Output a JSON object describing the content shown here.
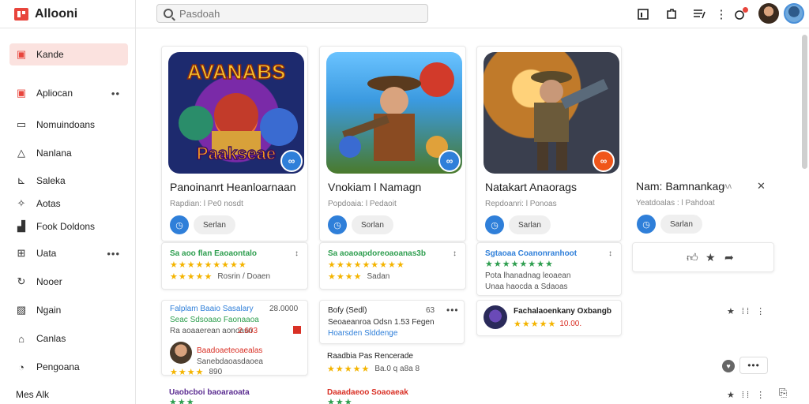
{
  "app": {
    "title": "Allooni"
  },
  "search": {
    "placeholder": "Pasdoah"
  },
  "topbar": {
    "icons": [
      "library-icon",
      "puzzle-icon",
      "list-icon",
      "more-vertical-icon",
      "notifications-icon",
      "profile-avatar",
      "account-avatar"
    ]
  },
  "sidebar": {
    "items": [
      {
        "label": "Kande",
        "icon": "home-icon",
        "active": true
      },
      {
        "label": "Apliocan",
        "icon": "apps-icon",
        "more": "••"
      },
      {
        "label": "Nomuindoans",
        "icon": "window-icon"
      },
      {
        "label": "Nanlana",
        "icon": "triangle-icon"
      },
      {
        "label": "Saleka",
        "icon": "chart-icon"
      },
      {
        "label": "Aotas",
        "icon": "star-icon"
      },
      {
        "label": "Fook Doldons",
        "icon": "bar-chart-icon"
      },
      {
        "label": "Uata",
        "icon": "grid-icon",
        "more": "•••"
      },
      {
        "label": "Nooer",
        "icon": "refresh-icon"
      },
      {
        "label": "Ngain",
        "icon": "image-icon"
      },
      {
        "label": "Canlas",
        "icon": "house-icon"
      },
      {
        "label": "Pengoana",
        "icon": "clock-icon"
      },
      {
        "label": "Mes Alk"
      }
    ]
  },
  "games": [
    {
      "title": "Panoinanrt Heanloarnaan",
      "sub": "Rapdian: l Pe0 nosdt",
      "pill": "Serlan",
      "art_text": "AVANABS",
      "art_text2": "Paakseae",
      "badge_color": "#2f7fd9"
    },
    {
      "title": "Vnokiam l Namagn",
      "sub": "Popdoaia: l Pedaoit",
      "pill": "Sorlan",
      "badge_color": "#2f7fd9"
    },
    {
      "title": "Natakart Anaorags",
      "sub": "Repdoanri: l Ponoas",
      "pill": "Sarlan",
      "badge_color": "#f0561a"
    },
    {
      "title": "Nam: Bamnankag",
      "sub": "Yeatdoalas : l Pahdoat",
      "pill": "Sarlan",
      "extra": "ᴧᴧ",
      "close": "✕"
    }
  ],
  "rating_cards": [
    {
      "line1": "Sa aoo flan Eaoaontalo",
      "line2": "Rosrin / Doaen",
      "more": "↕"
    },
    {
      "line1": "Sa aoaoapdoreoaoanas3b",
      "line2": "Sadan",
      "more": "↕"
    },
    {
      "line1": "Sgtaoaa Coanonranhoot",
      "line2": "Pota lhanadnag leoaean",
      "line3": "Unaa haocda a Sdaoas",
      "more": "↕"
    }
  ],
  "lower": {
    "c1": {
      "l1": "Falplam Baaio Sasalary",
      "l1b": "28.0000",
      "l2": "Seac Sdsoaao Faonaaoa",
      "l3": "Ra aoaaerean aonoasn",
      "l3b": "2.603",
      "l4": "Baadoaeteoaealas",
      "l5": "Sanebdaoasdaoea",
      "l6": "890"
    },
    "c2": {
      "l1": "Bofy (Sedl)",
      "l1b": "63",
      "l2": "Seoaeanroa Odsn 1.53 Fegen",
      "l3": "Hoarsden Slddenge"
    },
    "c3": {
      "l1": "Fachalaoenkany Oxbangb",
      "l2": "10.00."
    },
    "c4": {
      "l1": "Raadbia Pas Rencerade",
      "l2": "Ba.0 q a8a 8"
    },
    "c5": {
      "l1": "Uaobcboi baoaraoata",
      "l2": "Daaadaeoo Soaoaeak"
    }
  }
}
